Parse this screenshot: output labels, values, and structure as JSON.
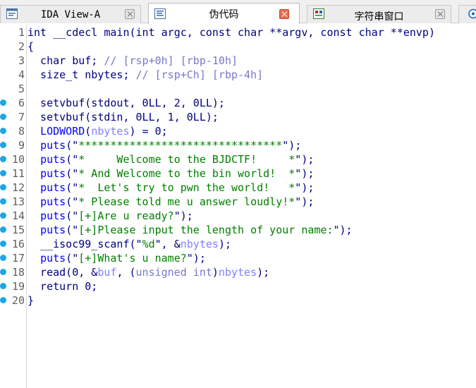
{
  "tabs": [
    {
      "label": "IDA View-A",
      "icon": "ida-view-icon",
      "active": false
    },
    {
      "label": "伪代码",
      "icon": "pseudocode-icon",
      "active": true
    },
    {
      "label": "字符串窗口",
      "icon": "strings-window-icon",
      "active": false
    }
  ],
  "colors": {
    "keyword": "#000080",
    "comment": "#7878c8",
    "string": "#008000",
    "variable": "#8080ff",
    "function": "#0000ff",
    "breakpoint_dot": "#1ca6e8",
    "close_active": "#e76b50"
  },
  "lines": [
    {
      "n": "1",
      "dot": false,
      "tokens": [
        [
          "default",
          "int __cdecl main(int argc, const char **argv, const char **envp)"
        ]
      ]
    },
    {
      "n": "2",
      "dot": false,
      "tokens": [
        [
          "default",
          "{"
        ]
      ]
    },
    {
      "n": "3",
      "dot": false,
      "tokens": [
        [
          "default",
          "  char buf; "
        ],
        [
          "comment",
          "// [rsp+0h] [rbp-10h]"
        ]
      ]
    },
    {
      "n": "4",
      "dot": false,
      "tokens": [
        [
          "default",
          "  size_t nbytes; "
        ],
        [
          "comment",
          "// [rsp+Ch] [rbp-4h]"
        ]
      ]
    },
    {
      "n": "5",
      "dot": false,
      "tokens": []
    },
    {
      "n": "6",
      "dot": true,
      "tokens": [
        [
          "default",
          "  setvbuf(stdout, 0LL, 2, 0LL);"
        ]
      ]
    },
    {
      "n": "7",
      "dot": true,
      "tokens": [
        [
          "default",
          "  setvbuf(stdin, 0LL, 1, 0LL);"
        ]
      ]
    },
    {
      "n": "8",
      "dot": true,
      "tokens": [
        [
          "default",
          "  "
        ],
        [
          "func",
          "LODWORD"
        ],
        [
          "default",
          "("
        ],
        [
          "var",
          "nbytes"
        ],
        [
          "default",
          ") = 0;"
        ]
      ]
    },
    {
      "n": "9",
      "dot": true,
      "tokens": [
        [
          "default",
          "  "
        ],
        [
          "func",
          "puts"
        ],
        [
          "default",
          "(\""
        ],
        [
          "string",
          "********************************"
        ],
        [
          "default",
          "\");"
        ]
      ]
    },
    {
      "n": "10",
      "dot": true,
      "tokens": [
        [
          "default",
          "  "
        ],
        [
          "func",
          "puts"
        ],
        [
          "default",
          "(\""
        ],
        [
          "string",
          "*     Welcome to the BJDCTF!     *"
        ],
        [
          "default",
          "\");"
        ]
      ]
    },
    {
      "n": "11",
      "dot": true,
      "tokens": [
        [
          "default",
          "  "
        ],
        [
          "func",
          "puts"
        ],
        [
          "default",
          "(\""
        ],
        [
          "string",
          "* And Welcome to the bin world!  *"
        ],
        [
          "default",
          "\");"
        ]
      ]
    },
    {
      "n": "12",
      "dot": true,
      "tokens": [
        [
          "default",
          "  "
        ],
        [
          "func",
          "puts"
        ],
        [
          "default",
          "(\""
        ],
        [
          "string",
          "*  Let's try to pwn the world!   *"
        ],
        [
          "default",
          "\");"
        ]
      ]
    },
    {
      "n": "13",
      "dot": true,
      "tokens": [
        [
          "default",
          "  "
        ],
        [
          "func",
          "puts"
        ],
        [
          "default",
          "(\""
        ],
        [
          "string",
          "* Please told me u answer loudly!*"
        ],
        [
          "default",
          "\");"
        ]
      ]
    },
    {
      "n": "14",
      "dot": true,
      "tokens": [
        [
          "default",
          "  "
        ],
        [
          "func",
          "puts"
        ],
        [
          "default",
          "(\""
        ],
        [
          "string",
          "[+]Are u ready?"
        ],
        [
          "default",
          "\");"
        ]
      ]
    },
    {
      "n": "15",
      "dot": true,
      "tokens": [
        [
          "default",
          "  "
        ],
        [
          "func",
          "puts"
        ],
        [
          "default",
          "(\""
        ],
        [
          "string",
          "[+]Please input the length of your name:"
        ],
        [
          "default",
          "\");"
        ]
      ]
    },
    {
      "n": "16",
      "dot": true,
      "tokens": [
        [
          "default",
          "  __isoc99_scanf(\""
        ],
        [
          "string",
          "%d"
        ],
        [
          "default",
          "\", &"
        ],
        [
          "var",
          "nbytes"
        ],
        [
          "default",
          ");"
        ]
      ]
    },
    {
      "n": "17",
      "dot": true,
      "tokens": [
        [
          "default",
          "  "
        ],
        [
          "func",
          "puts"
        ],
        [
          "default",
          "(\""
        ],
        [
          "string",
          "[+]What's u name?"
        ],
        [
          "default",
          "\");"
        ]
      ]
    },
    {
      "n": "18",
      "dot": true,
      "tokens": [
        [
          "default",
          "  read(0, &"
        ],
        [
          "var",
          "buf"
        ],
        [
          "default",
          ", ("
        ],
        [
          "comment",
          "unsigned int"
        ],
        [
          "default",
          ")"
        ],
        [
          "var",
          "nbytes"
        ],
        [
          "default",
          ");"
        ]
      ]
    },
    {
      "n": "19",
      "dot": true,
      "tokens": [
        [
          "default",
          "  return 0;"
        ]
      ]
    },
    {
      "n": "20",
      "dot": true,
      "tokens": [
        [
          "default",
          "}"
        ]
      ]
    }
  ]
}
